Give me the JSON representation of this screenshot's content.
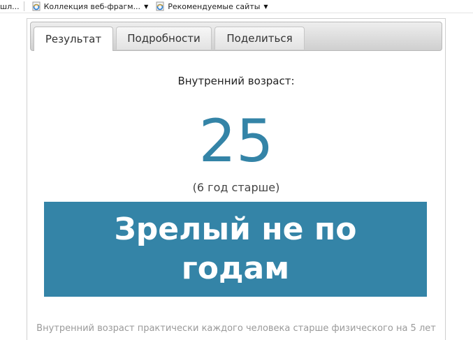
{
  "favorites": {
    "truncated_item": "шл...",
    "items": [
      {
        "label": "Коллекция веб-фрагм...",
        "icon": "ie-page-icon"
      },
      {
        "label": "Рекомендуемые сайты",
        "icon": "ie-page-icon"
      }
    ]
  },
  "tabs": [
    {
      "label": "Результат",
      "active": true
    },
    {
      "label": "Подробности",
      "active": false
    },
    {
      "label": "Поделиться",
      "active": false
    }
  ],
  "result": {
    "label": "Внутренний возраст:",
    "age": "25",
    "difference": "(6 год старше)",
    "verdict": "Зрелый не по годам",
    "description": "Внутренний возраст практически каждого человека старше физического на 5 лет"
  },
  "colors": {
    "accent": "#3484a7"
  }
}
